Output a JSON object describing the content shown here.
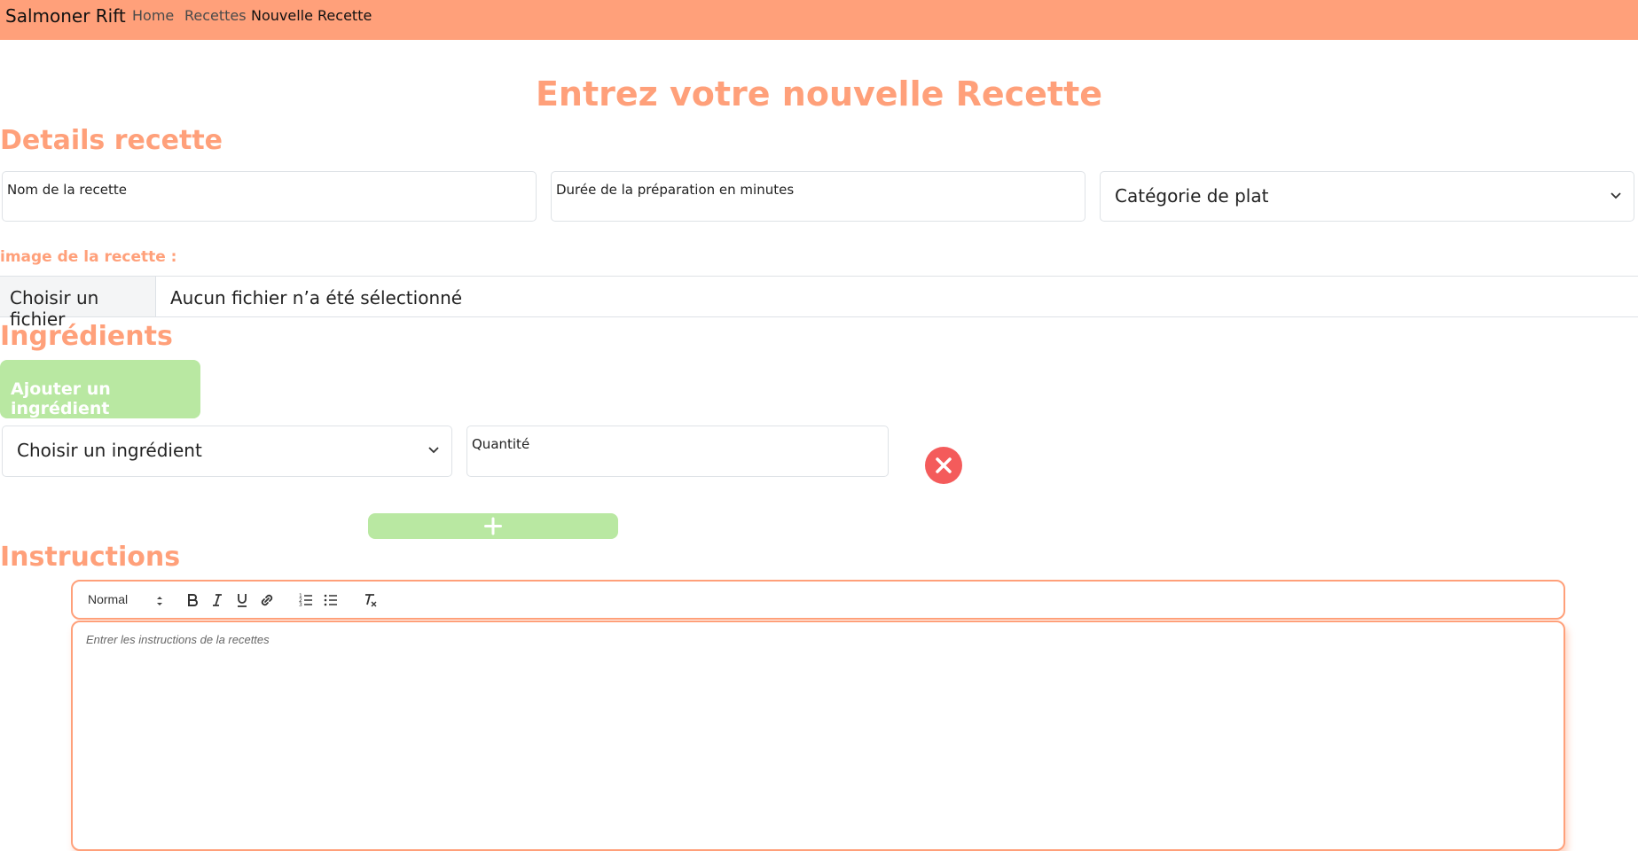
{
  "navbar": {
    "brand": "Salmoner Rift",
    "links": [
      "Home",
      "Recettes",
      "Nouvelle Recette"
    ],
    "bg_color": "#ffa07a"
  },
  "page": {
    "title": "Entrez votre nouvelle Recette"
  },
  "details": {
    "title": "Details recette",
    "name_placeholder": "Nom de la recette",
    "duration_placeholder": "Durée de la préparation en minutes",
    "category_select": "Catégorie de plat",
    "image_label": "image de la recette :",
    "file_button": "Choisir un fichier",
    "file_status": "Aucun fichier n’a été sélectionné"
  },
  "ingredients": {
    "title": "Ingrédients",
    "add_button": "Ajouter un ingrédient",
    "select": "Choisir un ingrédient",
    "quantity_placeholder": "Quantité",
    "remove_icon": "close-icon",
    "plus_icon": "plus-icon"
  },
  "instructions": {
    "title": "Instructions",
    "format_select": "Normal",
    "toolbar_icons": [
      "bold-icon",
      "italic-icon",
      "underline-icon",
      "link-icon",
      "ordered-list-icon",
      "bullet-list-icon",
      "clear-format-icon"
    ],
    "placeholder": "Entrer les instructions de la recettes"
  },
  "colors": {
    "accent": "#ffa07a",
    "success": "#b9e8a2",
    "danger": "#f45b5b"
  }
}
